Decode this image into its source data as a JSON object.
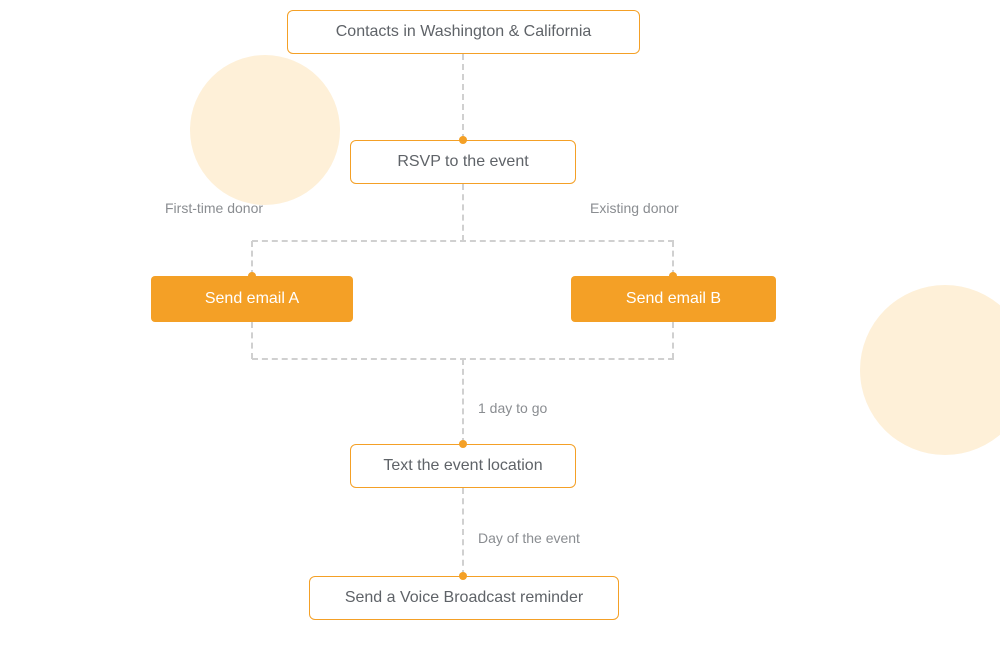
{
  "nodes": {
    "contacts": "Contacts in Washington & California",
    "rsvp": "RSVP to the event",
    "email_a": "Send email A",
    "email_b": "Send email B",
    "text_location": "Text the event location",
    "voice_reminder": "Send a Voice Broadcast reminder"
  },
  "labels": {
    "branch_left": "First-time donor",
    "branch_right": "Existing donor",
    "wait_1day": "1 day to go",
    "event_day": "Day of the event"
  },
  "colors": {
    "accent": "#f4a026",
    "text": "#5f6368",
    "label": "#8a8d91",
    "dash": "#d0d0d0",
    "bg_circle": "#fef0d8"
  }
}
